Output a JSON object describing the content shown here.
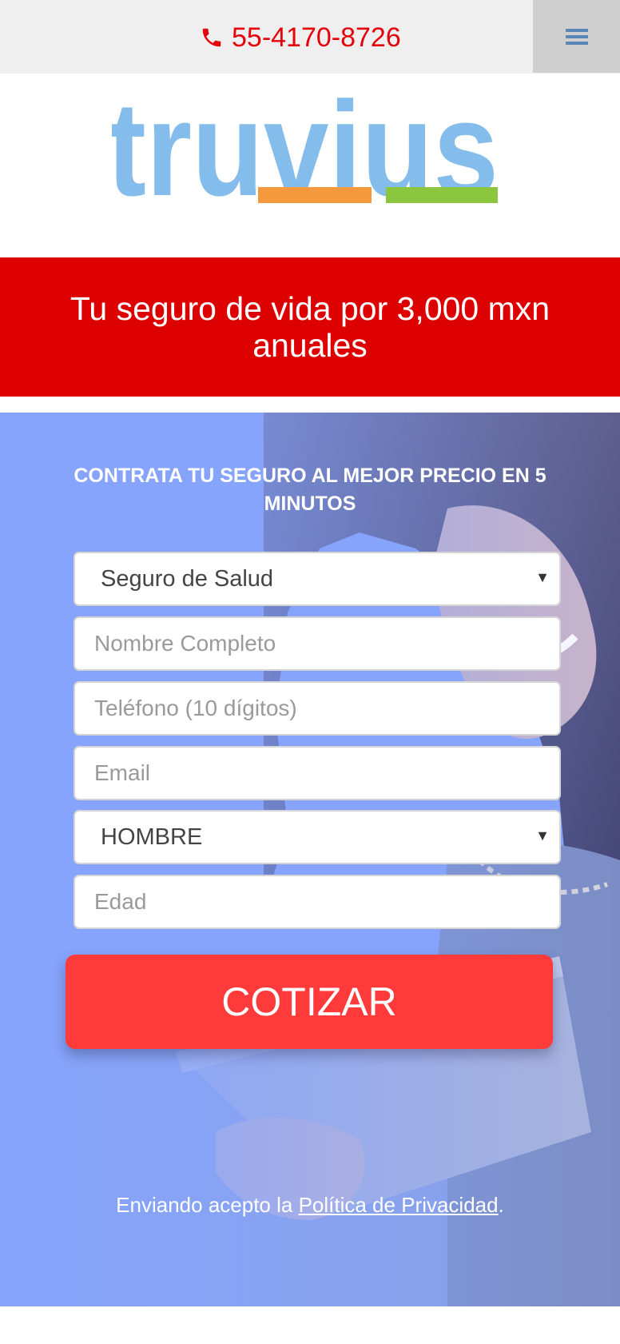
{
  "header": {
    "phone": "55-4170-8726",
    "phone_icon": "phone-icon",
    "menu_icon": "hamburger-menu-icon"
  },
  "logo": {
    "text": "truvius",
    "colors": {
      "letters": "#84bdeb",
      "bar_orange": "#f59a3c",
      "bar_green": "#8cc63f"
    }
  },
  "banner": {
    "headline": "Tu seguro de vida por 3,000 mxn anuales",
    "color": "#dd0000"
  },
  "form": {
    "title": "CONTRATA TU SEGURO AL MEJOR PRECIO EN 5 MINUTOS",
    "insurance_type": "Seguro de Salud",
    "name_placeholder": "Nombre Completo",
    "phone_placeholder": "Teléfono (10 dígitos)",
    "email_placeholder": "Email",
    "gender": "HOMBRE",
    "age_placeholder": "Edad",
    "submit_label": "COTIZAR",
    "submit_color": "#ff3a3a"
  },
  "legal": {
    "prefix": "Enviando acepto la ",
    "link": "Política de Privacidad",
    "suffix": "."
  }
}
